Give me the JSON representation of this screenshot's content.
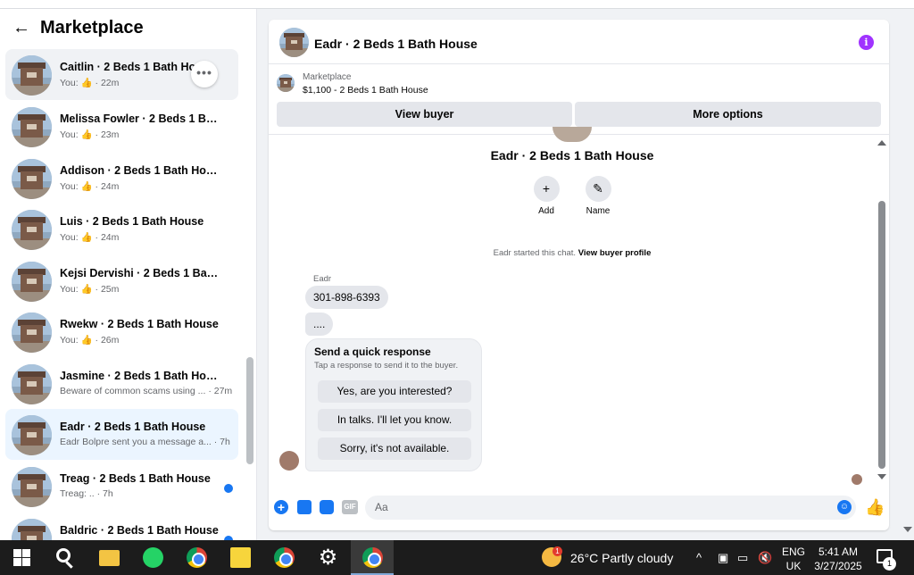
{
  "sidebar": {
    "title": "Marketplace",
    "conversations": [
      {
        "name": "Caitlin · 2 Beds 1 Bath House",
        "sub": "You: 👍 · 22m",
        "unread": false,
        "state": "hover"
      },
      {
        "name": "Melissa Fowler · 2 Beds 1 Bath ...",
        "sub": "You: 👍 · 23m",
        "unread": false,
        "state": ""
      },
      {
        "name": "Addison · 2 Beds 1 Bath House",
        "sub": "You: 👍 · 24m",
        "unread": false,
        "state": ""
      },
      {
        "name": "Luis · 2 Beds 1 Bath House",
        "sub": "You: 👍 · 24m",
        "unread": false,
        "state": ""
      },
      {
        "name": "Kejsi Dervishi · 2 Beds 1 Bath H...",
        "sub": "You: 👍 · 25m",
        "unread": false,
        "state": ""
      },
      {
        "name": "Rwekw · 2 Beds 1 Bath House",
        "sub": "You: 👍 · 26m",
        "unread": false,
        "state": ""
      },
      {
        "name": "Jasmine · 2 Beds 1 Bath House",
        "sub": "Beware of common scams using ... · 27m",
        "unread": false,
        "state": ""
      },
      {
        "name": "Eadr · 2 Beds 1 Bath House",
        "sub": "Eadr Bolpre sent you a message a... · 7h",
        "unread": false,
        "state": "active"
      },
      {
        "name": "Treag · 2 Beds 1 Bath House",
        "sub": "Treag: .. · 7h",
        "unread": true,
        "state": ""
      },
      {
        "name": "Baldric · 2 Beds 1 Bath House",
        "sub": "",
        "unread": true,
        "state": ""
      }
    ]
  },
  "chat": {
    "title": "Eadr · 2 Beds 1 Bath House",
    "listing_category": "Marketplace",
    "listing_price": "$1,100 - 2 Beds 1 Bath House",
    "view_buyer": "View buyer",
    "more_options": "More options",
    "conversation_name": "Eadr · 2 Beds 1 Bath House",
    "add_label": "Add",
    "name_label": "Name",
    "started_text": "Eadr started this chat.",
    "started_link": "View buyer profile",
    "sender": "Eadr",
    "message_1": "301-898-6393",
    "message_2": "....",
    "quick_title": "Send a quick response",
    "quick_sub": "Tap a response to send it to the buyer.",
    "quick_1": "Yes, are you interested?",
    "quick_2": "In talks. I'll let you know.",
    "quick_3": "Sorry, it's not available.",
    "input_placeholder": "Aa",
    "gif_label": "GIF"
  },
  "taskbar": {
    "weather": "26°C  Partly cloudy",
    "weather_badge": "1",
    "lang_1": "ENG",
    "lang_2": "UK",
    "time": "5:41 AM",
    "date": "3/27/2025",
    "notif_count": "1"
  },
  "colors": {
    "accent": "#1877f2",
    "active_row": "#ebf5ff",
    "info": "#a033ff"
  }
}
